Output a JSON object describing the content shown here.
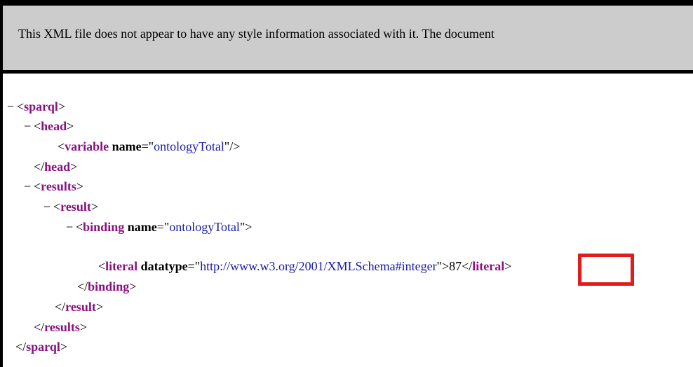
{
  "info_bar": {
    "message": "This XML file does not appear to have any style information associated with it. The document"
  },
  "tree": {
    "collapse_symbol": "−",
    "sparql_tag": "sparql",
    "head_tag": "head",
    "variable_tag": "variable",
    "variable_attr_name": "name",
    "variable_attr_value": "ontologyTotal",
    "results_tag": "results",
    "result_tag": "result",
    "binding_tag": "binding",
    "binding_attr_name": "name",
    "binding_attr_value": "ontologyTotal",
    "literal_tag": "literal",
    "literal_attr_name": "datatype",
    "literal_attr_value": "http://www.w3.org/2001/XMLSchema#integer",
    "literal_text": "87"
  },
  "highlight": {
    "color": "#e01c1c"
  }
}
